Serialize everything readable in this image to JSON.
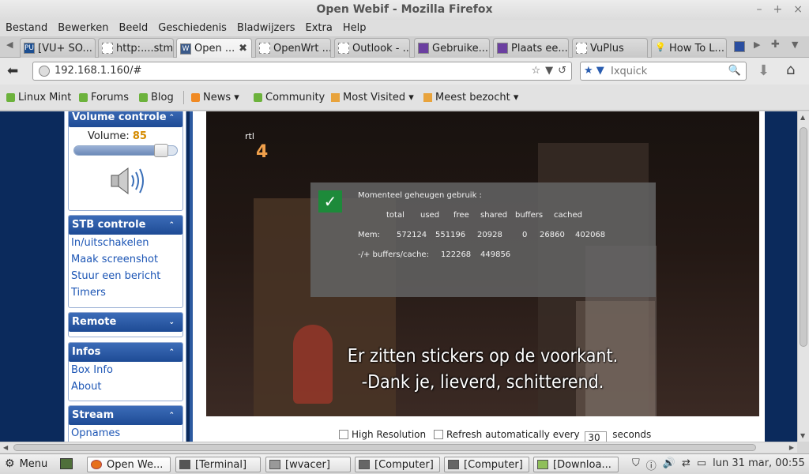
{
  "window": {
    "title": "Open Webif - Mozilla Firefox",
    "controls": [
      "–",
      "+",
      "×"
    ]
  },
  "menu": [
    "Bestand",
    "Bewerken",
    "Beeld",
    "Geschiedenis",
    "Bladwijzers",
    "Extra",
    "Help"
  ],
  "tabs": [
    {
      "label": "[VU+ SO...",
      "icon": "PU"
    },
    {
      "label": "http:....stm",
      "icon": ""
    },
    {
      "label": "Open ...",
      "icon": "W",
      "active": true,
      "close": "✖"
    },
    {
      "label": "OpenWrt ...",
      "icon": ""
    },
    {
      "label": "Outlook - ...",
      "icon": ""
    },
    {
      "label": "Gebruike...",
      "icon": ""
    },
    {
      "label": "Plaats ee...",
      "icon": ""
    },
    {
      "label": "VuPlus",
      "icon": ""
    },
    {
      "label": "How To L...",
      "icon": "💡"
    }
  ],
  "tab_arrows": {
    "left": "◀",
    "right": "▶",
    "new": "✚",
    "list": "▼"
  },
  "nav": {
    "back": "⬅",
    "url": "192.168.1.160/#",
    "url_icons": [
      "☆",
      "▼",
      "↺"
    ],
    "search_engine": "★ ▼",
    "search_placeholder": "Ixquick",
    "search_icon": "🔍",
    "download": "⬇",
    "home": "⌂"
  },
  "bookmarks": [
    {
      "label": "Linux Mint",
      "color": "#6cb23c"
    },
    {
      "label": "Forums",
      "color": "#6cb23c"
    },
    {
      "label": "Blog",
      "color": "#6cb23c"
    },
    {
      "label": "News ▾",
      "color": "#f08a24"
    },
    {
      "label": "Community",
      "color": "#6cb23c"
    },
    {
      "label": "Most Visited ▾",
      "color": "#e8a33c"
    },
    {
      "label": "Meest bezocht ▾",
      "color": "#e8a33c"
    }
  ],
  "sidebar": {
    "volume": {
      "title": "Volume controle",
      "label": "Volume:",
      "value": "85",
      "level": 0.85,
      "arrow": "⌃"
    },
    "stb": {
      "title": "STB controle",
      "arrow": "⌃",
      "links": [
        "In/uitschakelen",
        "Maak screenshot",
        "Stuur een bericht",
        "Timers"
      ]
    },
    "remote": {
      "title": "Remote",
      "arrow": "⌄"
    },
    "infos": {
      "title": "Infos",
      "arrow": "⌃",
      "links": [
        "Box Info",
        "About"
      ]
    },
    "stream": {
      "title": "Stream",
      "arrow": "⌃",
      "links": [
        "Opnames"
      ]
    }
  },
  "screenshot": {
    "logo_top": "rtl",
    "logo_num": "4",
    "subtitle1": "Er zitten stickers op de voorkant.",
    "subtitle2": "-Dank je, lieverd, schitterend.",
    "osd": {
      "check": "✓",
      "title": "Momenteel geheugen gebruik :",
      "headers": [
        "total",
        "used",
        "free",
        "shared",
        "buffers",
        "cached"
      ],
      "mem_label": "Mem:",
      "mem_values": [
        "572124",
        "551196",
        "20928",
        "0",
        "26860",
        "402068"
      ],
      "buf_label": "-/+ buffers/cache:",
      "buf_values": [
        "122268",
        "449856"
      ]
    }
  },
  "controls": {
    "high_res": "High Resolution",
    "refresh": "Refresh automatically every",
    "interval": "30",
    "unit": "seconds"
  },
  "taskbar": {
    "menu": "Menu",
    "tasks": [
      "Open We...",
      "[Terminal]",
      "[wvacer]",
      "[Computer]",
      "[Computer]",
      "[Downloa..."
    ],
    "clock": "lun 31 mar, 00:55"
  }
}
